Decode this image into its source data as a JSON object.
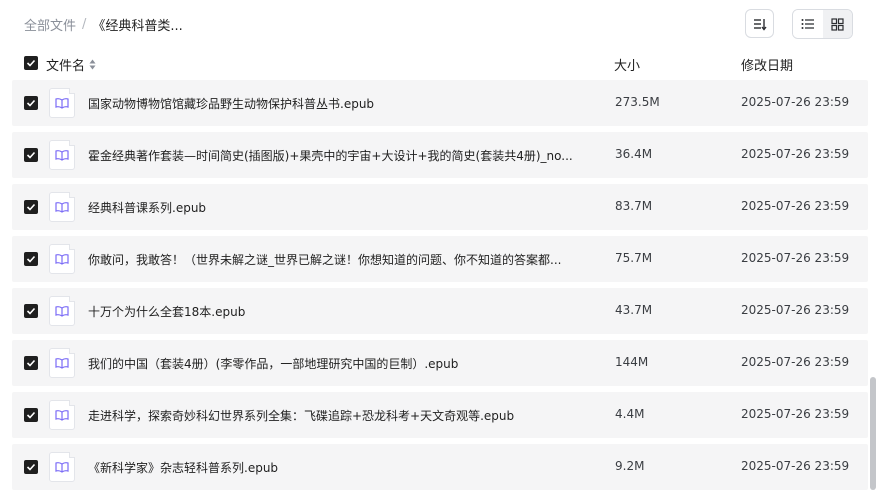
{
  "breadcrumb": {
    "root": "全部文件",
    "separator": "/",
    "current": "《经典科普类..."
  },
  "toolbar": {
    "sort_icon": "sort-lines-icon",
    "list_view_icon": "list-view-icon",
    "grid_view_icon": "grid-view-icon",
    "active_view": "list"
  },
  "table": {
    "headers": {
      "name": "文件名",
      "size": "大小",
      "date": "修改日期"
    },
    "rows": [
      {
        "name": "国家动物博物馆馆藏珍品野生动物保护科普丛书.epub",
        "size": "273.5M",
        "date": "2025-07-26 23:59",
        "checked": true
      },
      {
        "name": "霍金经典著作套装—时间简史(插图版)+果壳中的宇宙+大设计+我的简史(套装共4册)_no...",
        "size": "36.4M",
        "date": "2025-07-26 23:59",
        "checked": true
      },
      {
        "name": "经典科普课系列.epub",
        "size": "83.7M",
        "date": "2025-07-26 23:59",
        "checked": true
      },
      {
        "name": "你敢问，我敢答！（世界未解之谜_世界已解之谜！你想知道的问题、你不知道的答案都...",
        "size": "75.7M",
        "date": "2025-07-26 23:59",
        "checked": true
      },
      {
        "name": "十万个为什么全套18本.epub",
        "size": "43.7M",
        "date": "2025-07-26 23:59",
        "checked": true
      },
      {
        "name": "我们的中国（套装4册）(李零作品，一部地理研究中国的巨制）.epub",
        "size": "144M",
        "date": "2025-07-26 23:59",
        "checked": true
      },
      {
        "name": "走进科学，探索奇妙科幻世界系列全集：飞碟追踪+恐龙科考+天文奇观等.epub",
        "size": "4.4M",
        "date": "2025-07-26 23:59",
        "checked": true
      },
      {
        "name": "《新科学家》杂志轻科普系列.epub",
        "size": "9.2M",
        "date": "2025-07-26 23:59",
        "checked": true
      }
    ]
  },
  "colors": {
    "row_bg": "#f5f5f6",
    "checkbox": "#1f1f1f",
    "file_icon_accent": "#7b6cf6"
  }
}
